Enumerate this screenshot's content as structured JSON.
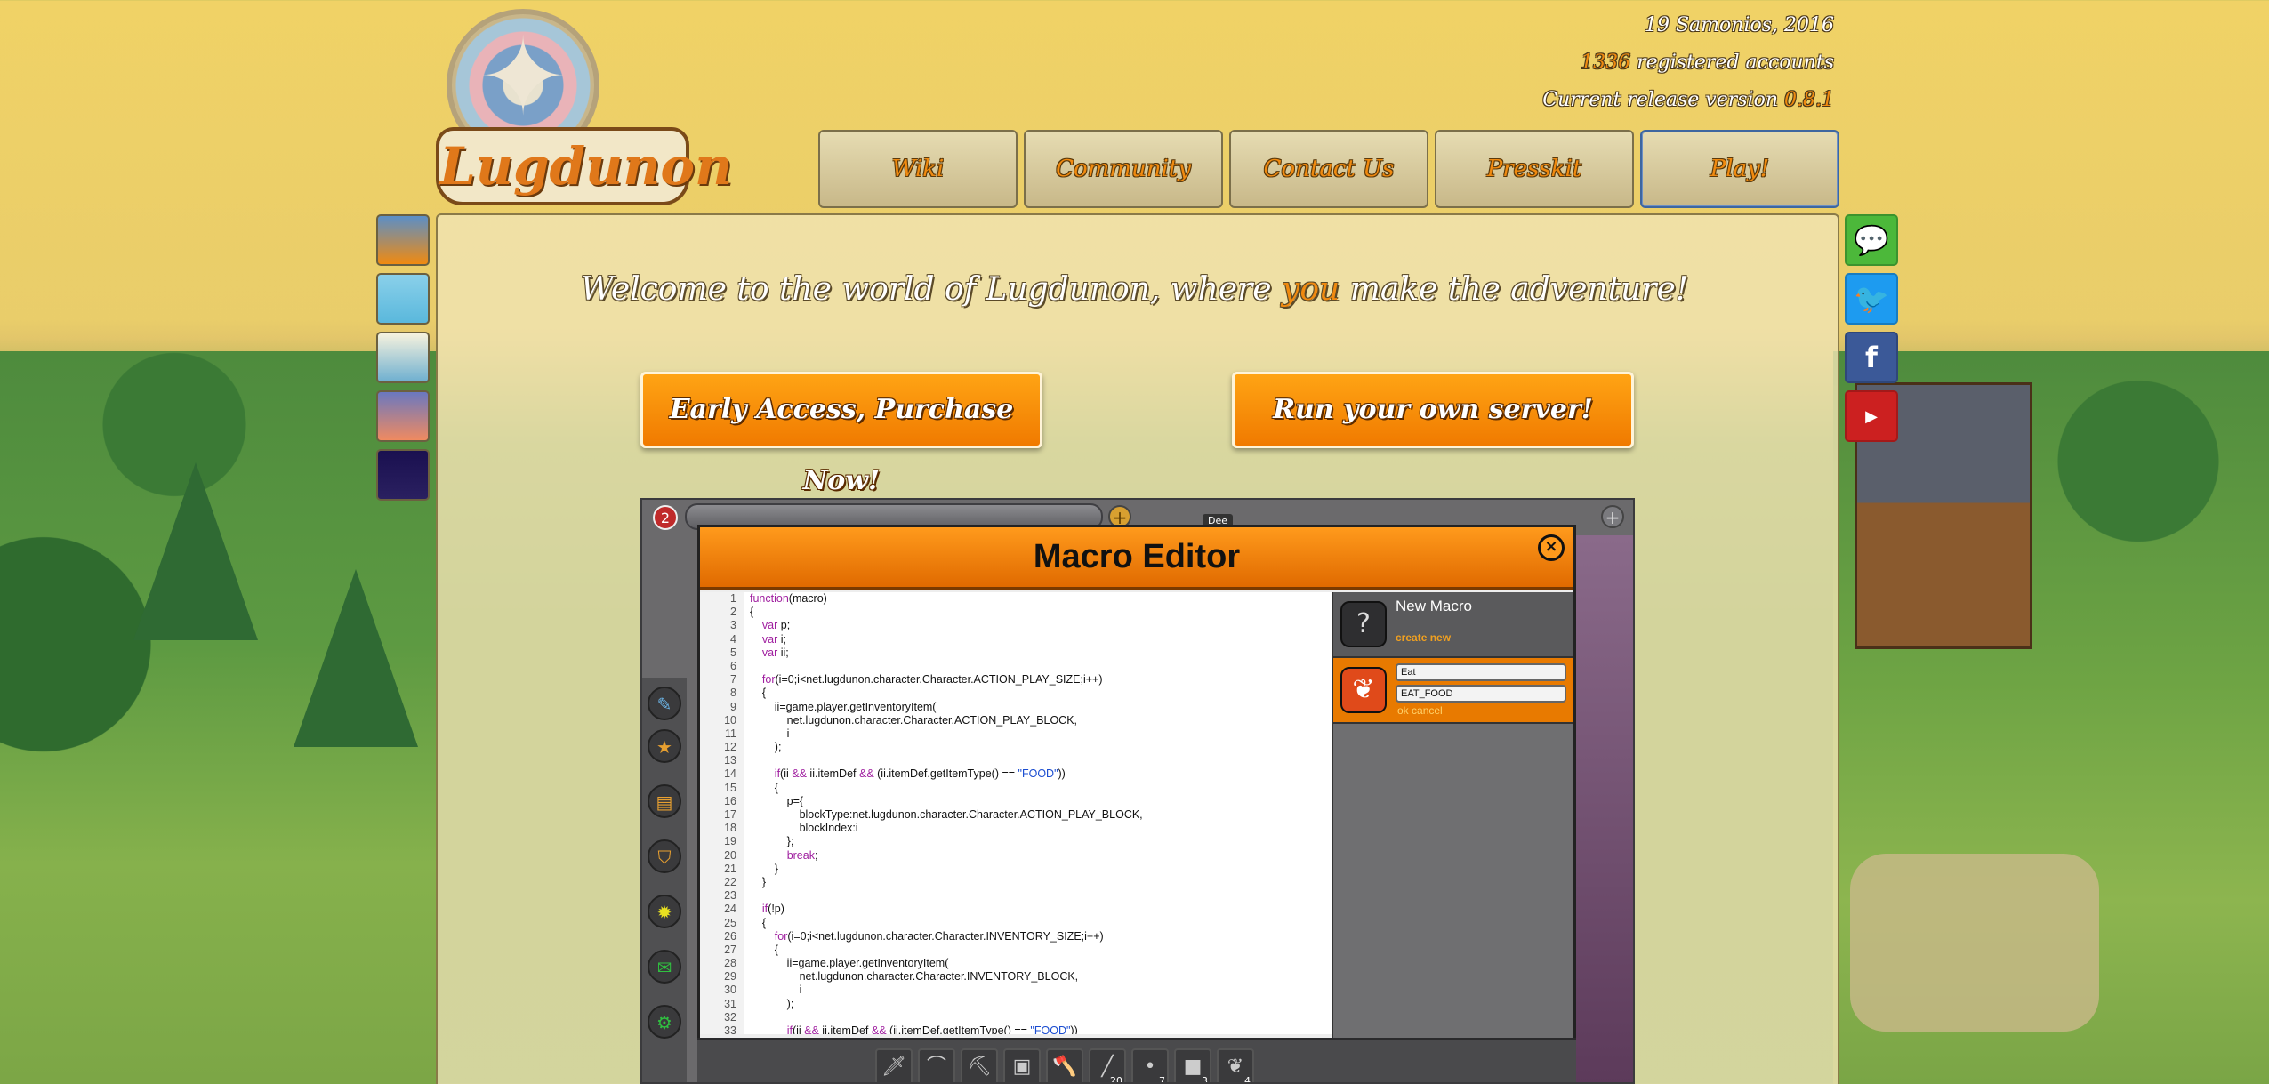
{
  "header": {
    "date": "19 Samonios, 2016",
    "accounts_count": "1336",
    "accounts_label": "registered accounts",
    "version_label": "Current release version",
    "version": "0.8.1",
    "logo_text": "Lugdunon"
  },
  "nav": {
    "items": [
      {
        "label": "Wiki"
      },
      {
        "label": "Community"
      },
      {
        "label": "Contact Us"
      },
      {
        "label": "Presskit"
      },
      {
        "label": "Play!"
      }
    ]
  },
  "themes": {
    "swatches": [
      {
        "name": "sunset",
        "color_top": "#5b8fc7",
        "color_bottom": "#f08a10"
      },
      {
        "name": "sky",
        "color_top": "#8ad0ea",
        "color_bottom": "#5ab8dc"
      },
      {
        "name": "day",
        "color_top": "#f6f2de",
        "color_bottom": "#6fb0d0"
      },
      {
        "name": "dusk",
        "color_top": "#6a78c0",
        "color_bottom": "#f08a60"
      },
      {
        "name": "night",
        "color_top": "#1a1050",
        "color_bottom": "#2a2060"
      }
    ]
  },
  "social": {
    "items": [
      {
        "name": "forum",
        "icon": "speech-bubble-icon",
        "color": "#4cb83a"
      },
      {
        "name": "twitter",
        "icon": "twitter-icon",
        "color": "#1d9bf0"
      },
      {
        "name": "facebook",
        "icon": "facebook-icon",
        "color": "#3b5998"
      },
      {
        "name": "youtube",
        "icon": "youtube-icon",
        "color": "#cc2020"
      }
    ]
  },
  "welcome": {
    "before": "Welcome to the world of Lugdunon, where ",
    "accent": "you",
    "after": " make the adventure!"
  },
  "cta": {
    "purchase": "Early Access, Purchase Now!",
    "server": "Run your own server!"
  },
  "screenshot": {
    "badge": "2",
    "tag": "Dee",
    "macro_title": "Macro Editor",
    "code_lines": [
      "function(macro)",
      "{",
      "    var p;",
      "    var i;",
      "    var ii;",
      "",
      "    for(i=0;i<net.lugdunon.character.Character.ACTION_PLAY_SIZE;i++)",
      "    {",
      "        ii=game.player.getInventoryItem(",
      "            net.lugdunon.character.Character.ACTION_PLAY_BLOCK,",
      "            i",
      "        );",
      "",
      "        if(ii && ii.itemDef && (ii.itemDef.getItemType() == \"FOOD\"))",
      "        {",
      "            p={",
      "                blockType:net.lugdunon.character.Character.ACTION_PLAY_BLOCK,",
      "                blockIndex:i",
      "            };",
      "            break;",
      "        }",
      "    }",
      "",
      "    if(!p)",
      "    {",
      "        for(i=0;i<net.lugdunon.character.Character.INVENTORY_SIZE;i++)",
      "        {",
      "            ii=game.player.getInventoryItem(",
      "                net.lugdunon.character.Character.INVENTORY_BLOCK,",
      "                i",
      "            );",
      "",
      "            if(ii && ii.itemDef && (ii.itemDef.getItemType() == \"FOOD\"))"
    ],
    "macros": {
      "new_title": "New Macro",
      "new_link": "create new",
      "name_value": "Eat",
      "id_value": "EAT_FOOD",
      "ok": "ok",
      "cancel": "cancel"
    },
    "hotbar": [
      {
        "icon": "sword-icon",
        "count": ""
      },
      {
        "icon": "bow-icon",
        "count": ""
      },
      {
        "icon": "pickaxe-icon",
        "count": ""
      },
      {
        "icon": "barrel-icon",
        "count": ""
      },
      {
        "icon": "axe-icon",
        "count": ""
      },
      {
        "icon": "stick-icon",
        "count": "20"
      },
      {
        "icon": "seed-icon",
        "count": "7"
      },
      {
        "icon": "block-icon",
        "count": "3"
      },
      {
        "icon": "meat-icon",
        "count": "4"
      }
    ]
  }
}
